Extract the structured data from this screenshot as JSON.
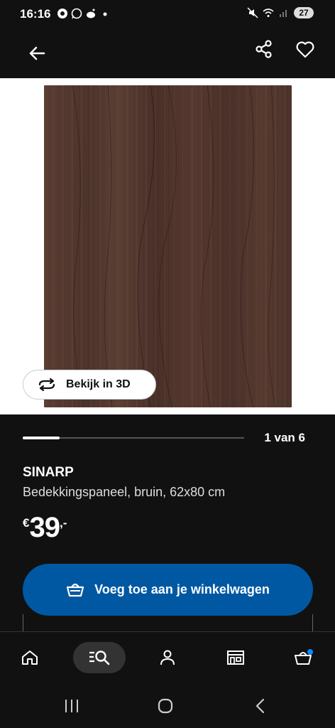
{
  "status_bar": {
    "time": "16:16",
    "battery": "27"
  },
  "app_bar": {
    "back_icon": "arrow-left-icon",
    "share_icon": "share-icon",
    "favorite_icon": "heart-icon"
  },
  "gallery": {
    "view_3d_label": "Bekijk in 3D",
    "counter": "1 van 6",
    "current_index": 1,
    "total": 6
  },
  "product": {
    "name": "SINARP",
    "description": "Bedekkingspaneel, bruin, 62x80 cm",
    "price_currency": "€",
    "price_main": "39",
    "price_suffix": ",-"
  },
  "actions": {
    "add_to_cart_label": "Voeg toe aan je winkelwagen"
  },
  "bottom_nav": [
    "home-icon",
    "search-list-icon",
    "profile-icon",
    "store-icon",
    "cart-icon"
  ],
  "colors": {
    "primary_blue": "#0058a3",
    "background": "#111111",
    "wood": "#523a30"
  }
}
